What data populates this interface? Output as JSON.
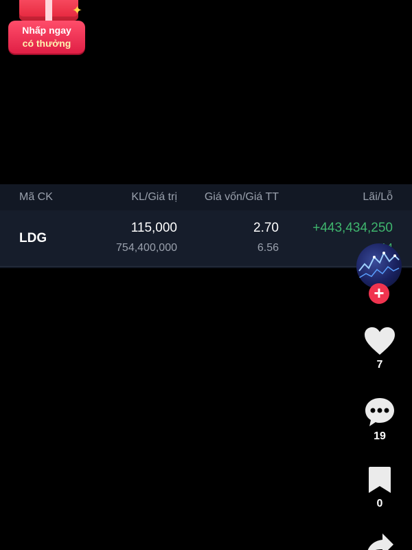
{
  "promo": {
    "line1": "Nhấp ngay",
    "line2": "có thưởng"
  },
  "table": {
    "headers": {
      "symbol": "Mã CK",
      "volume_value": "KL/Giá trị",
      "cost_market": "Giá vốn/Giá TT",
      "profit_loss": "Lãi/Lỗ"
    },
    "row": {
      "symbol": "LDG",
      "volume": "115,000",
      "value": "754,400,000",
      "cost_price": "2.70",
      "market_price": "6.56",
      "profit": "+443,434,250",
      "profit_percent": "+14"
    },
    "colors": {
      "positive": "#3fb66e",
      "panel_bg": "#121824",
      "muted_text": "#9aa1ad"
    }
  },
  "actions": {
    "follow_icon": "plus-icon",
    "like": {
      "icon": "heart-icon",
      "count": "7"
    },
    "comment": {
      "icon": "comment-icon",
      "count": "19"
    },
    "save": {
      "icon": "bookmark-icon",
      "count": "0"
    },
    "share": {
      "icon": "share-icon"
    }
  }
}
